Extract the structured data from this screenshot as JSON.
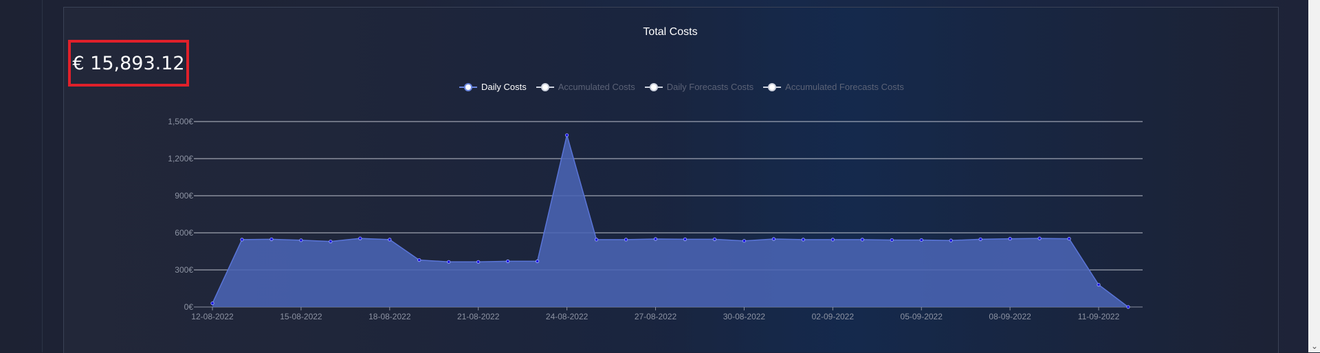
{
  "total": {
    "amount": "€ 15,893.12",
    "highlight_color": "#e0202a"
  },
  "chart_data": {
    "type": "area",
    "title": "Total Costs",
    "legend": [
      {
        "label": "Daily Costs",
        "active": true,
        "color": "#6a86e0"
      },
      {
        "label": "Accumulated Costs",
        "active": false,
        "color": "#cfd4e0"
      },
      {
        "label": "Daily Forecasts Costs",
        "active": false,
        "color": "#cfd4e0"
      },
      {
        "label": "Accumulated Forecasts Costs",
        "active": false,
        "color": "#cfd4e0"
      }
    ],
    "legend_placement": "top-center",
    "grid": true,
    "ylim": [
      0,
      1500
    ],
    "yticks": [
      0,
      300,
      600,
      900,
      1200,
      1500
    ],
    "ytick_labels": [
      "0€",
      "300€",
      "600€",
      "900€",
      "1,200€",
      "1,500€"
    ],
    "xtick_labels": [
      "12-08-2022",
      "15-08-2022",
      "18-08-2022",
      "21-08-2022",
      "24-08-2022",
      "27-08-2022",
      "30-08-2022",
      "02-09-2022",
      "05-09-2022",
      "08-09-2022",
      "11-09-2022"
    ],
    "x": [
      "12-08-2022",
      "13-08-2022",
      "14-08-2022",
      "15-08-2022",
      "16-08-2022",
      "17-08-2022",
      "18-08-2022",
      "19-08-2022",
      "20-08-2022",
      "21-08-2022",
      "22-08-2022",
      "23-08-2022",
      "24-08-2022",
      "25-08-2022",
      "26-08-2022",
      "27-08-2022",
      "28-08-2022",
      "29-08-2022",
      "30-08-2022",
      "31-08-2022",
      "01-09-2022",
      "02-09-2022",
      "03-09-2022",
      "04-09-2022",
      "05-09-2022",
      "06-09-2022",
      "07-09-2022",
      "08-09-2022",
      "09-09-2022",
      "10-09-2022",
      "11-09-2022",
      "12-09-2022"
    ],
    "series": [
      {
        "name": "Daily Costs",
        "color": "#5a75d8",
        "fill": "#4a64b4",
        "values": [
          30,
          545,
          548,
          540,
          530,
          555,
          545,
          380,
          365,
          365,
          370,
          370,
          1390,
          545,
          545,
          550,
          548,
          548,
          535,
          550,
          545,
          545,
          545,
          542,
          542,
          538,
          548,
          552,
          555,
          552,
          180,
          0
        ]
      }
    ]
  }
}
